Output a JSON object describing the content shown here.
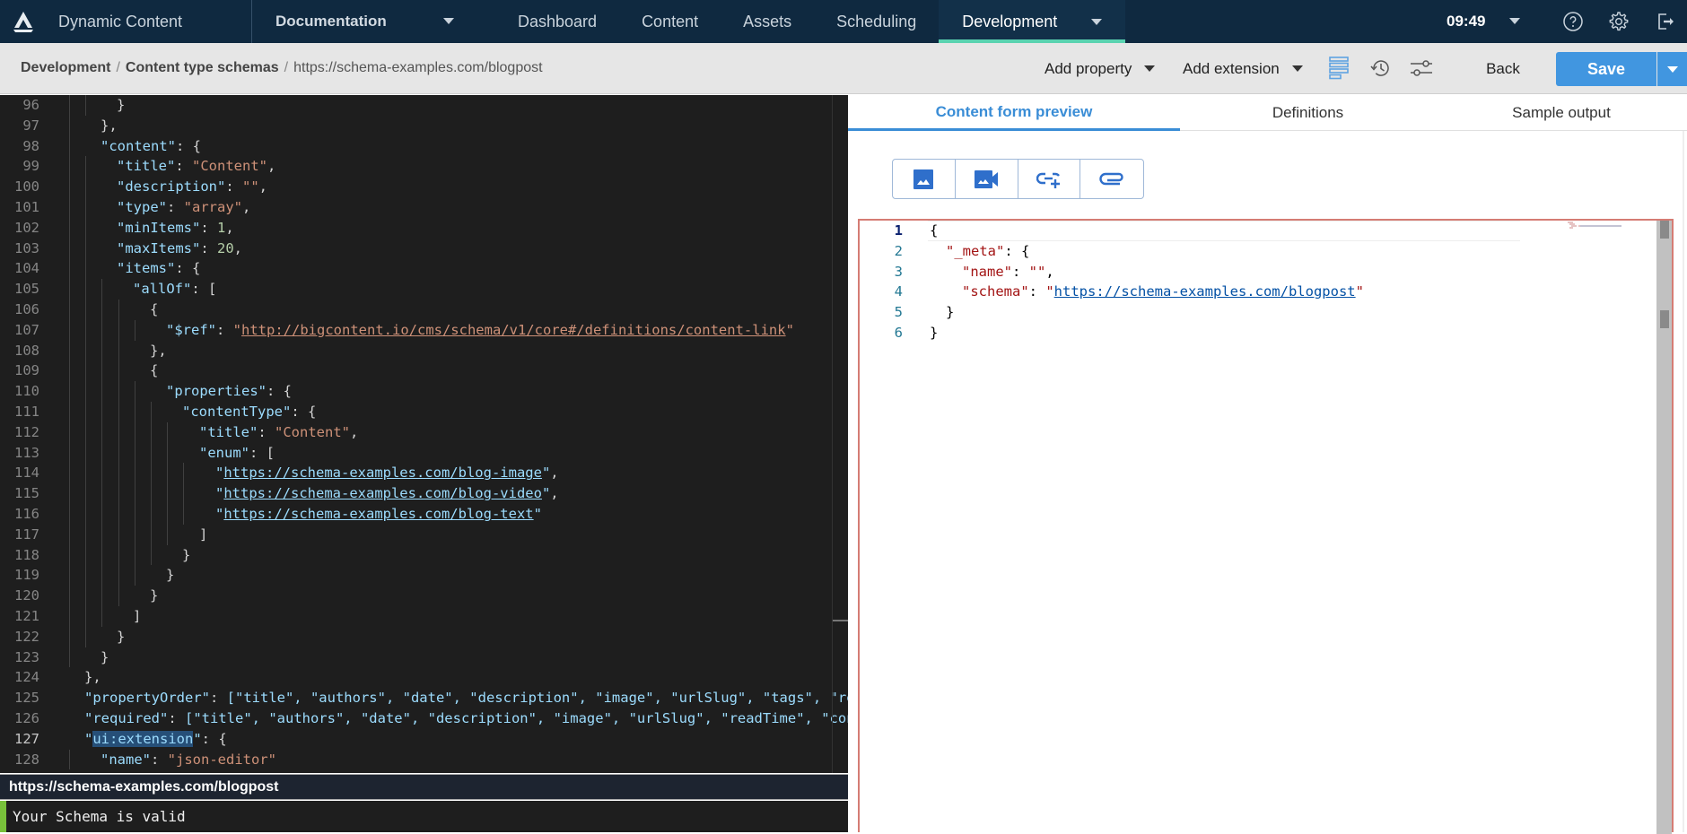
{
  "topbar": {
    "app_name": "Dynamic Content",
    "hub_name": "Documentation",
    "nav": [
      {
        "label": "Dashboard",
        "active": false
      },
      {
        "label": "Content",
        "active": false
      },
      {
        "label": "Assets",
        "active": false
      },
      {
        "label": "Scheduling",
        "active": false
      },
      {
        "label": "Development",
        "active": true
      }
    ],
    "time": "09:49",
    "icons": [
      "help-icon",
      "settings-icon",
      "logout-icon"
    ],
    "active_indicator_color": "#5ad3b0"
  },
  "subbar": {
    "breadcrumb": [
      "Development",
      "Content type schemas",
      "https://schema-examples.com/blogpost"
    ],
    "add_property_label": "Add property",
    "add_extension_label": "Add extension",
    "back_label": "Back",
    "save_label": "Save",
    "save_color": "#4196e0"
  },
  "editor": {
    "current_line": 127,
    "lines": [
      {
        "n": 96,
        "indent": 2
      },
      {
        "n": 97,
        "indent": 1
      },
      {
        "n": 98,
        "indent": 1
      },
      {
        "n": 99,
        "indent": 2
      },
      {
        "n": 100,
        "indent": 2
      },
      {
        "n": 101,
        "indent": 2
      },
      {
        "n": 102,
        "indent": 2
      },
      {
        "n": 103,
        "indent": 2
      },
      {
        "n": 104,
        "indent": 2
      },
      {
        "n": 105,
        "indent": 3
      },
      {
        "n": 106,
        "indent": 4
      },
      {
        "n": 107,
        "indent": 5
      },
      {
        "n": 108,
        "indent": 4
      },
      {
        "n": 109,
        "indent": 4
      },
      {
        "n": 110,
        "indent": 5
      },
      {
        "n": 111,
        "indent": 6
      },
      {
        "n": 112,
        "indent": 7
      },
      {
        "n": 113,
        "indent": 7
      },
      {
        "n": 114,
        "indent": 8
      },
      {
        "n": 115,
        "indent": 8
      },
      {
        "n": 116,
        "indent": 8
      },
      {
        "n": 117,
        "indent": 7
      },
      {
        "n": 118,
        "indent": 6
      },
      {
        "n": 119,
        "indent": 5
      },
      {
        "n": 120,
        "indent": 4
      },
      {
        "n": 121,
        "indent": 3
      },
      {
        "n": 122,
        "indent": 2
      },
      {
        "n": 123,
        "indent": 1
      },
      {
        "n": 124,
        "indent": 0
      },
      {
        "n": 125,
        "indent": 0
      },
      {
        "n": 126,
        "indent": 0
      },
      {
        "n": 127,
        "indent": 0
      },
      {
        "n": 128,
        "indent": 1
      }
    ],
    "tokens": {
      "l96": "}",
      "l97": "},",
      "l98_key": "\"content\"",
      "l98_rest": ": {",
      "l99_key": "\"title\"",
      "l99_val": "\"Content\"",
      "l100_key": "\"description\"",
      "l100_val": "\"\"",
      "l101_key": "\"type\"",
      "l101_val": "\"array\"",
      "l102_key": "\"minItems\"",
      "l102_val": "1",
      "l103_key": "\"maxItems\"",
      "l103_val": "20",
      "l104_key": "\"items\"",
      "l105_key": "\"allOf\"",
      "l105_rest": ": [",
      "l106": "{",
      "l107_key": "\"$ref\"",
      "l107_url": "http://bigcontent.io/cms/schema/v1/core#/definitions/content-link",
      "l108": "},",
      "l109": "{",
      "l110_key": "\"properties\"",
      "l111_key": "\"contentType\"",
      "l112_key": "\"title\"",
      "l112_val": "\"Content\"",
      "l113_key": "\"enum\"",
      "l114_url": "https://schema-examples.com/blog-image",
      "l115_url": "https://schema-examples.com/blog-video",
      "l116_url": "https://schema-examples.com/blog-text",
      "l117": "]",
      "l118": "}",
      "l119": "}",
      "l120": "}",
      "l121": "]",
      "l122": "}",
      "l123": "}",
      "l124": "},",
      "l125_key": "\"propertyOrder\"",
      "l125_list": "[\"title\", \"authors\", \"date\", \"description\", \"image\", \"urlSlug\", \"tags\", \"rea",
      "l126_key": "\"required\"",
      "l126_list": "[\"title\", \"authors\", \"date\", \"description\", \"image\", \"urlSlug\", \"readTime\", \"cont",
      "l127_sel": "ui:extension",
      "l128_key": "\"name\"",
      "l128_val": "\"json-editor\""
    }
  },
  "status": {
    "schema_url": "https://schema-examples.com/blogpost",
    "message": "Your Schema is valid",
    "valid_color": "#78c13a"
  },
  "preview": {
    "tabs": [
      {
        "label": "Content form preview",
        "active": true
      },
      {
        "label": "Definitions",
        "active": false
      },
      {
        "label": "Sample output",
        "active": false
      }
    ],
    "media_buttons": [
      "image-icon",
      "video-icon",
      "add-link-icon",
      "attachment-icon"
    ],
    "json": {
      "current_line": 1,
      "meta_key": "\"_meta\"",
      "name_key": "\"name\"",
      "name_val": "\"\"",
      "schema_key": "\"schema\"",
      "schema_val": "https://schema-examples.com/blogpost"
    }
  }
}
